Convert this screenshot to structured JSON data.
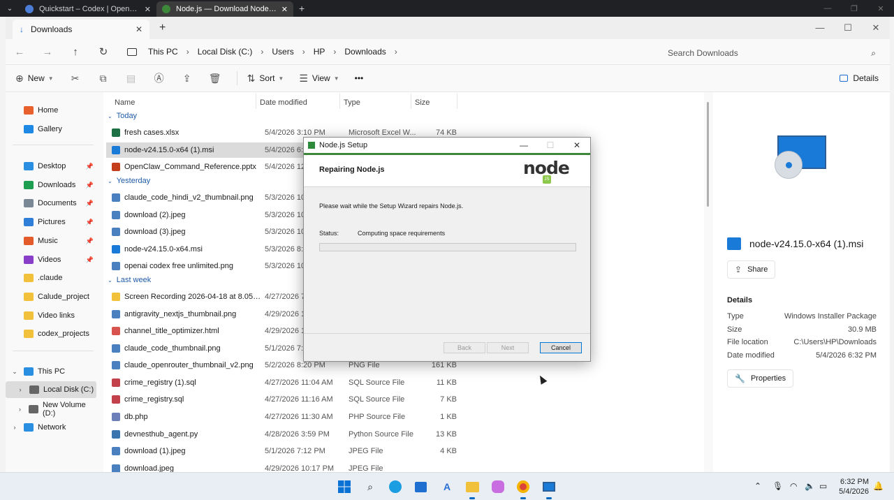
{
  "browser": {
    "tabs": [
      {
        "title": "Quickstart – Codex | OpenAI De",
        "close": "✕"
      },
      {
        "title": "Node.js — Download Node.js®",
        "close": "✕"
      }
    ],
    "new_tab": "+"
  },
  "explorer": {
    "tab_title": "Downloads",
    "tab_close": "✕",
    "new_tab": "+",
    "breadcrumb": [
      "This PC",
      "Local Disk (C:)",
      "Users",
      "HP",
      "Downloads"
    ],
    "search_placeholder": "Search Downloads",
    "toolbar": {
      "new": "New",
      "sort": "Sort",
      "view": "View",
      "more": "•••",
      "details": "Details"
    },
    "columns": {
      "name": "Name",
      "date": "Date modified",
      "type": "Type",
      "size": "Size"
    }
  },
  "sidebar": {
    "quick": [
      {
        "label": "Home",
        "icon": "home-icon",
        "color": "#e8612c"
      },
      {
        "label": "Gallery",
        "icon": "gallery-icon",
        "color": "#1e88e5"
      }
    ],
    "pinned": [
      {
        "label": "Desktop",
        "icon": "desktop-icon",
        "color": "#2a8fe0",
        "pin": "📌"
      },
      {
        "label": "Downloads",
        "icon": "download-icon",
        "color": "#1e9e50",
        "pin": "📌"
      },
      {
        "label": "Documents",
        "icon": "documents-icon",
        "color": "#7a8896",
        "pin": "📌"
      },
      {
        "label": "Pictures",
        "icon": "pictures-icon",
        "color": "#2f7fd8",
        "pin": "📌"
      },
      {
        "label": "Music",
        "icon": "music-icon",
        "color": "#e35a2b",
        "pin": "📌"
      },
      {
        "label": "Videos",
        "icon": "videos-icon",
        "color": "#8a3fc8",
        "pin": "📌"
      },
      {
        "label": ".claude",
        "icon": "folder-icon",
        "color": "#f2c13b"
      },
      {
        "label": "Calude_project",
        "icon": "folder-icon",
        "color": "#f2c13b"
      },
      {
        "label": "Video links",
        "icon": "folder-icon",
        "color": "#f2c13b"
      },
      {
        "label": "codex_projects",
        "icon": "folder-icon",
        "color": "#f2c13b"
      }
    ],
    "tree": [
      {
        "label": "This PC",
        "arrow": "⌄",
        "color": "#2a8fe0"
      },
      {
        "label": "Local Disk (C:)",
        "arrow": "›",
        "color": "#666"
      },
      {
        "label": "New Volume (D:)",
        "arrow": "›",
        "color": "#666"
      },
      {
        "label": "Network",
        "arrow": "›",
        "color": "#2a8fe0"
      }
    ]
  },
  "groups": {
    "today": "Today",
    "yesterday": "Yesterday",
    "last_week": "Last week"
  },
  "files": [
    {
      "name": "fresh cases.xlsx",
      "date": "5/4/2026 3:10 PM",
      "type": "Microsoft Excel W...",
      "size": "74 KB",
      "color": "#1d7044"
    },
    {
      "name": "node-v24.15.0-x64 (1).msi",
      "date": "5/4/2026 6:32",
      "type": "",
      "size": "",
      "color": "#1a7ad8"
    },
    {
      "name": "OpenClaw_Command_Reference.pptx",
      "date": "5/4/2026 12:20",
      "type": "",
      "size": "",
      "color": "#c43e1c"
    },
    {
      "name": "claude_code_hindi_v2_thumbnail.png",
      "date": "5/3/2026 10:01",
      "type": "",
      "size": "",
      "color": "#4a7fc0"
    },
    {
      "name": "download (2).jpeg",
      "date": "5/3/2026 10:38",
      "type": "",
      "size": "",
      "color": "#4a7fc0"
    },
    {
      "name": "download (3).jpeg",
      "date": "5/3/2026 10:39",
      "type": "",
      "size": "",
      "color": "#4a7fc0"
    },
    {
      "name": "node-v24.15.0-x64.msi",
      "date": "5/3/2026 8:49",
      "type": "",
      "size": "",
      "color": "#1a7ad8"
    },
    {
      "name": "openai codex free unlimited.png",
      "date": "5/3/2026 10:47",
      "type": "",
      "size": "",
      "color": "#4a7fc0"
    },
    {
      "name": "Screen Recording 2026-04-18 at 8.05.21 P...",
      "date": "4/27/2026 7:38",
      "type": "",
      "size": "",
      "color": "#f2c13b"
    },
    {
      "name": "antigravity_nextjs_thumbnail.png",
      "date": "4/29/2026 10:2",
      "type": "",
      "size": "",
      "color": "#4a7fc0"
    },
    {
      "name": "channel_title_optimizer.html",
      "date": "4/29/2026 11:0",
      "type": "",
      "size": "",
      "color": "#d9534f"
    },
    {
      "name": "claude_code_thumbnail.png",
      "date": "5/1/2026 7:22",
      "type": "",
      "size": "",
      "color": "#4a7fc0"
    },
    {
      "name": "claude_openrouter_thumbnail_v2.png",
      "date": "5/2/2026 8:20 PM",
      "type": "PNG File",
      "size": "161 KB",
      "color": "#4a7fc0"
    },
    {
      "name": "crime_registry (1).sql",
      "date": "4/27/2026 11:04 AM",
      "type": "SQL Source File",
      "size": "11 KB",
      "color": "#c2414b"
    },
    {
      "name": "crime_registry.sql",
      "date": "4/27/2026 11:16 AM",
      "type": "SQL Source File",
      "size": "7 KB",
      "color": "#c2414b"
    },
    {
      "name": "db.php",
      "date": "4/27/2026 11:30 AM",
      "type": "PHP Source File",
      "size": "1 KB",
      "color": "#6c7fb8"
    },
    {
      "name": "devnesthub_agent.py",
      "date": "4/28/2026 3:59 PM",
      "type": "Python Source File",
      "size": "13 KB",
      "color": "#3a75b0"
    },
    {
      "name": "download (1).jpeg",
      "date": "5/1/2026 7:12 PM",
      "type": "JPEG File",
      "size": "4 KB",
      "color": "#4a7fc0"
    },
    {
      "name": "download.jpeg",
      "date": "4/29/2026 10:17 PM",
      "type": "JPEG File",
      "size": "",
      "color": "#4a7fc0"
    }
  ],
  "details_pane": {
    "file_name": "node-v24.15.0-x64 (1).msi",
    "share": "Share",
    "heading": "Details",
    "rows": [
      {
        "k": "Type",
        "v": "Windows Installer Package"
      },
      {
        "k": "Size",
        "v": "30.9 MB"
      },
      {
        "k": "File location",
        "v": "C:\\Users\\HP\\Downloads"
      },
      {
        "k": "Date modified",
        "v": "5/4/2026 6:32 PM"
      }
    ],
    "properties": "Properties"
  },
  "dialog": {
    "title": "Node.js Setup",
    "header": "Repairing Node.js",
    "logo_word": "node",
    "logo_badge": "JS",
    "message": "Please wait while the Setup Wizard repairs Node.js.",
    "status_label": "Status:",
    "status_value": "Computing space requirements",
    "progress": 0,
    "back": "Back",
    "next": "Next",
    "cancel": "Cancel"
  },
  "clock": {
    "time": "6:32 PM",
    "date": "5/4/2026"
  }
}
